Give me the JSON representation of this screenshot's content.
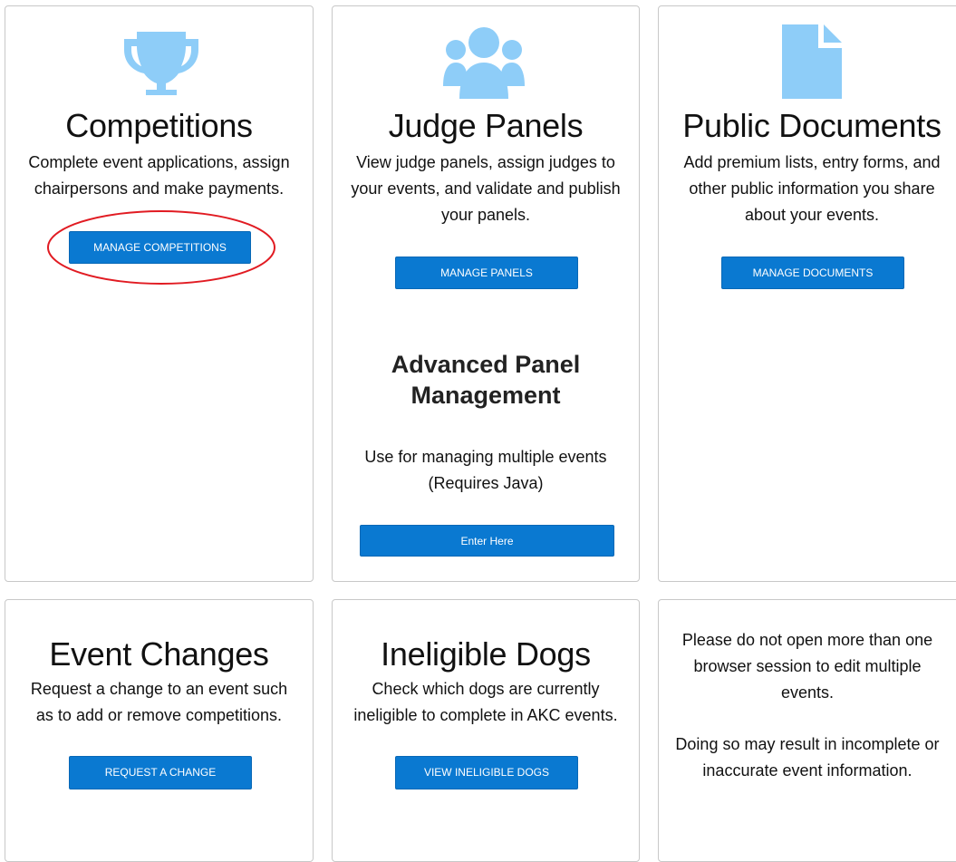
{
  "colors": {
    "accent": "#0a79d1",
    "icon": "#8ecdf8",
    "annotation": "#e11b22"
  },
  "cards": {
    "competitions": {
      "icon": "trophy-icon",
      "title": "Competitions",
      "desc_lines": [
        "Complete event applications, assign",
        "chairpersons and make payments."
      ],
      "button": "MANAGE COMPETITIONS"
    },
    "judge_panels": {
      "icon": "users-icon",
      "title": "Judge Panels",
      "desc_lines": [
        "View judge panels, assign judges to",
        "your events, and validate and publish",
        "your panels."
      ],
      "button": "MANAGE PANELS",
      "advanced": {
        "title_lines": [
          "Advanced Panel",
          "Management"
        ],
        "desc_lines": [
          "Use for managing multiple events",
          "(Requires Java)"
        ],
        "button": "Enter Here"
      }
    },
    "public_documents": {
      "icon": "document-icon",
      "title": "Public Documents",
      "desc_lines": [
        "Add premium lists, entry forms, and",
        "other public information you share",
        "about your events."
      ],
      "button": "MANAGE DOCUMENTS"
    },
    "event_changes": {
      "title": "Event Changes",
      "desc_lines": [
        "Request a change to an event such",
        "as to add or remove competitions."
      ],
      "button": "REQUEST A CHANGE"
    },
    "ineligible_dogs": {
      "title": "Ineligible Dogs",
      "desc_lines": [
        "Check which dogs are currently",
        "ineligible to complete in AKC events."
      ],
      "button": "VIEW INELIGIBLE DOGS"
    },
    "notice": {
      "lines": [
        "Please do not open more than one",
        "browser session to edit multiple",
        "events.",
        "",
        "Doing so may result in incomplete or",
        "inaccurate event information."
      ]
    }
  }
}
